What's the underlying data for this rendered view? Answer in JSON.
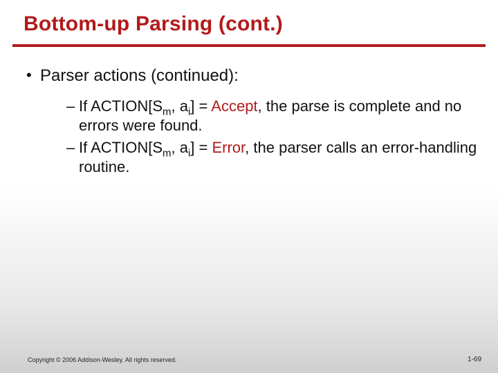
{
  "title": "Bottom-up Parsing (cont.)",
  "bullet1": "Parser actions (continued):",
  "item1_pre": "If ACTION[S",
  "item1_sub1": "m",
  "item1_mid1": ", a",
  "item1_sub2": "i",
  "item1_mid2": "] = ",
  "item1_keyword": "Accept",
  "item1_post": ", the parse is complete and no errors were found.",
  "item2_pre": "If ACTION[S",
  "item2_sub1": "m",
  "item2_mid1": ", a",
  "item2_sub2": "i",
  "item2_mid2": "] = ",
  "item2_keyword": "Error",
  "item2_post": ", the parser calls an error-handling routine.",
  "copyright": "Copyright © 2006 Addison-Wesley. All rights reserved.",
  "pagenum": "1-69"
}
